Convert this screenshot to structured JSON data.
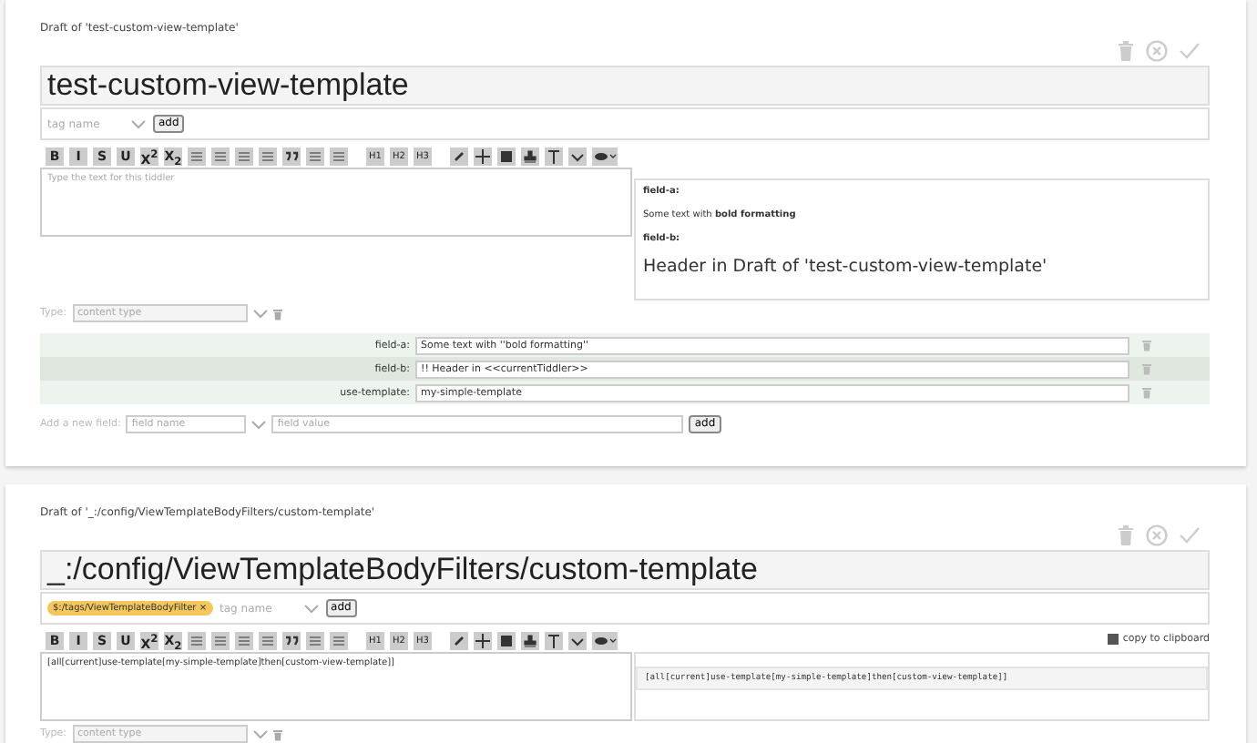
{
  "drafts": [
    {
      "heading": "Draft of 'test-custom-view-template'",
      "title": "test-custom-view-template",
      "tag_placeholder": "tag name",
      "add_tag": "add",
      "toolbar": [
        "B",
        "I",
        "S",
        "U",
        "X$^{2}$",
        "X$_{2}$",
        "H1",
        "H2",
        "H3"
      ],
      "text_placeholder": "Type the text for this tiddler",
      "type_label": "Type:",
      "type_placeholder": "content type",
      "preview": {
        "kind": "fields",
        "blocks": [
          {
            "kind": "label",
            "text": "field-a:"
          },
          {
            "kind": "para",
            "text": "Some text with **bold formatting**"
          },
          {
            "kind": "label",
            "text": "field-b:"
          },
          {
            "kind": "header",
            "text": "Header in Draft of 'test-custom-view-template'"
          }
        ]
      },
      "fields": [
        {
          "name": "field-a:",
          "value": "Some text with ''bold formatting''"
        },
        {
          "name": "field-b:",
          "value": "!! Header in <<currentTiddler>>"
        },
        {
          "name": "use-template:",
          "value": "my-simple-template"
        }
      ],
      "new_field": {
        "label": "Add a new field:",
        "name_placeholder": "field name",
        "value_placeholder": "field value",
        "button": "add"
      }
    },
    {
      "heading": "Draft of '_:/config/ViewTemplateBodyFilters/custom-template'",
      "title": "_:/config/ViewTemplateBodyFilters/custom-template",
      "tags": [
        "$:/tags/ViewTemplateBodyFilter ×"
      ],
      "tag_placeholder": "tag name",
      "add_tag": "add",
      "toolbar": [
        "B",
        "I",
        "S",
        "U",
        "X$^{2}$",
        "X$_{2}$",
        "H1",
        "H2",
        "H3"
      ],
      "text": "[all[current]use-template[my-simple-template]then[custom-view-template]]",
      "type_label": "Type:",
      "type_placeholder": "content type",
      "preview": {
        "kind": "code",
        "copy": "copy to clipboard",
        "code": "[all[current]use-template[my-simple-template]then[custom-view-template]]"
      }
    }
  ]
}
